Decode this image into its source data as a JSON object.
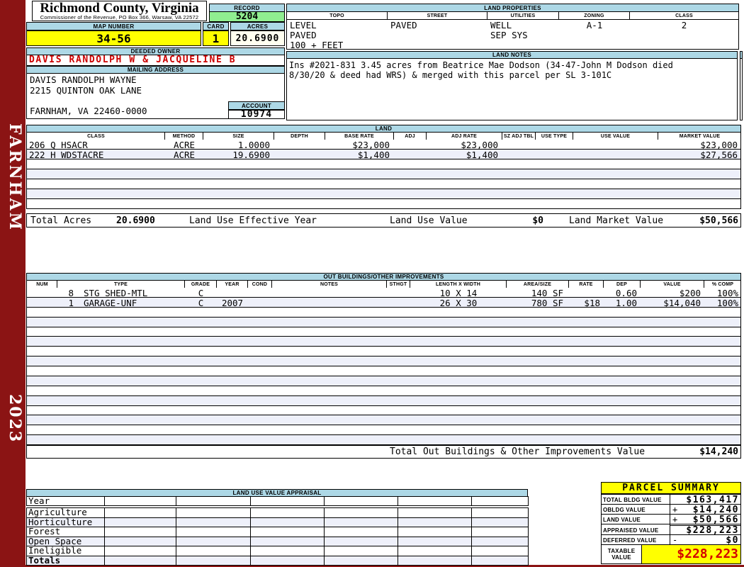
{
  "sidebar": {
    "district": "FARNHAM",
    "year": "2023"
  },
  "header": {
    "county": "Richmond County, Virginia",
    "commissioner_line": "Commissioner of the Revenue, PO Box 366, Warsaw, VA 22572",
    "record_label": "RECORD",
    "record_value": "5204",
    "map_number_label": "MAP NUMBER",
    "map_number_value": "34-56",
    "card_label": "CARD",
    "card_value": "1",
    "acres_label": "ACRES",
    "acres_value": "20.6900"
  },
  "owner": {
    "deeded_owner_label": "DEEDED OWNER",
    "deeded_owner": "DAVIS RANDOLPH W & JACQUELINE B",
    "mailing_address_label": "MAILING ADDRESS",
    "address_lines": [
      "DAVIS RANDOLPH WAYNE",
      "2215 QUINTON OAK LANE",
      "",
      "FARNHAM, VA 22460-0000"
    ],
    "account_label": "ACCOUNT",
    "account_value": "10974"
  },
  "land_properties": {
    "title": "LAND PROPERTIES",
    "columns": [
      "TOPO",
      "STREET",
      "UTILITIES",
      "ZONING",
      "CLASS"
    ],
    "topo": [
      "LEVEL",
      "PAVED",
      "100 + FEET"
    ],
    "street": [
      "PAVED"
    ],
    "utilities": [
      "WELL",
      "SEP SYS"
    ],
    "zoning": "A-1",
    "class": "2"
  },
  "land_notes": {
    "title": "LAND NOTES",
    "lines": [
      "Ins #2021-831 3.45 acres from Beatrice Mae Dodson (34-47-John M Dodson died",
      "8/30/20 & deed had WRS) & merged with this parcel per SL 3-101C"
    ]
  },
  "land_table": {
    "title": "LAND",
    "columns": [
      "CLASS",
      "METHOD",
      "SIZE",
      "DEPTH",
      "BASE RATE",
      "ADJ",
      "ADJ RATE",
      "SZ ADJ TBL",
      "USE TYPE",
      "USE VALUE",
      "MARKET VALUE"
    ],
    "rows": [
      {
        "class": "206 Q HSACR",
        "method": "ACRE",
        "size": "1.0000",
        "depth": "",
        "base_rate": "$23,000",
        "adj": "",
        "adj_rate": "$23,000",
        "sz_adj_tbl": "",
        "use_type": "",
        "use_value": "",
        "market_value": "$23,000"
      },
      {
        "class": "222 H WDSTACRE",
        "method": "ACRE",
        "size": "19.6900",
        "depth": "",
        "base_rate": "$1,400",
        "adj": "",
        "adj_rate": "$1,400",
        "sz_adj_tbl": "",
        "use_type": "",
        "use_value": "",
        "market_value": "$27,566"
      }
    ],
    "empty_row_count": 5,
    "totals": {
      "total_acres_label": "Total Acres",
      "total_acres": "20.6900",
      "effective_year_label": "Land Use Effective Year",
      "land_use_value_label": "Land Use Value",
      "land_use_value": "$0",
      "land_market_value_label": "Land Market Value",
      "land_market_value": "$50,566"
    }
  },
  "out_buildings": {
    "title": "OUT BUILDINGS/OTHER IMPROVEMENTS",
    "columns": [
      "NUM",
      "TYPE",
      "GRADE",
      "YEAR",
      "COND",
      "NOTES",
      "STHGT",
      "LENGTH X WIDTH",
      "AREA/SIZE",
      "RATE",
      "DEP",
      "VALUE",
      "% COMP"
    ],
    "rows": [
      {
        "num": "8",
        "type": "STG SHED-MTL",
        "grade": "C",
        "year": "",
        "cond": "",
        "notes": "",
        "sthgt": "",
        "length_width": "10 X 14",
        "area_size": "140 SF",
        "rate": "",
        "dep": "0.60",
        "value": "$200",
        "pct_comp": "100%"
      },
      {
        "num": "1",
        "type": "GARAGE-UNF",
        "grade": "C",
        "year": "2007",
        "cond": "",
        "notes": "",
        "sthgt": "",
        "length_width": "26 X 30",
        "area_size": "780 SF",
        "rate": "$18",
        "dep": "1.00",
        "value": "$14,040",
        "pct_comp": "100%"
      }
    ],
    "empty_row_count": 14,
    "total_label": "Total Out Buildings & Other Improvements Value",
    "total_value": "$14,240"
  },
  "land_use_appraisal": {
    "title": "LAND USE VALUE APPRAISAL",
    "row_labels": [
      "Year",
      "Agriculture",
      "Horticulture",
      "Forest",
      "Open Space",
      "Ineligible",
      "Totals"
    ]
  },
  "parcel_summary": {
    "title": "PARCEL SUMMARY",
    "rows": [
      {
        "label": "TOTAL BLDG VALUE",
        "op": "",
        "value": "$163,417"
      },
      {
        "label": "OBLDG VALUE",
        "op": "+",
        "value": "$14,240"
      },
      {
        "label": "LAND VALUE",
        "op": "+",
        "value": "$50,566"
      },
      {
        "label": "APPRAISED VALUE",
        "op": "",
        "value": "$228,223"
      },
      {
        "label": "DEFERRED VALUE",
        "op": "-",
        "value": "$0"
      }
    ],
    "taxable_label": "TAXABLE VALUE",
    "taxable_value": "$228,223"
  },
  "colors": {
    "border_maroon": "#8b1414",
    "header_blue": "#add8e6",
    "highlight_yellow": "#ffff00",
    "record_green": "#90ee90",
    "acres_ivory": "#fffff0",
    "row_stripe": "#eef0fa",
    "owner_red": "#cc0000",
    "taxable_red": "#d40000"
  }
}
